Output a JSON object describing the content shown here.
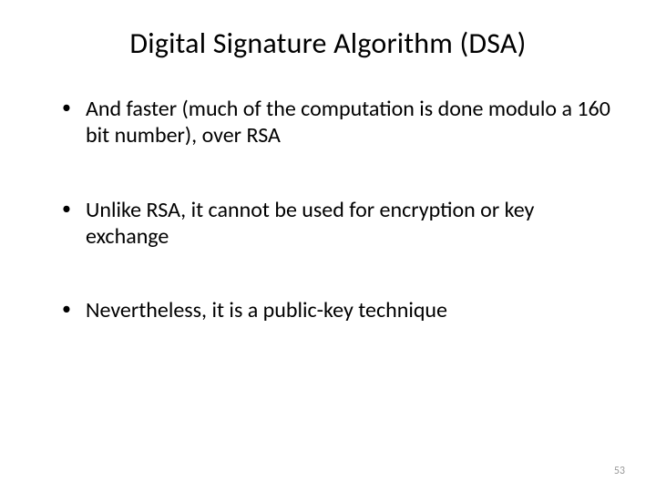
{
  "slide": {
    "title": "Digital Signature Algorithm (DSA)",
    "bullets": [
      "And faster (much of the computation is done modulo a 160 bit number), over RSA",
      "Unlike RSA, it cannot be used for encryption or key exchange",
      "Nevertheless, it is a public-key technique"
    ],
    "page_number": "53"
  }
}
